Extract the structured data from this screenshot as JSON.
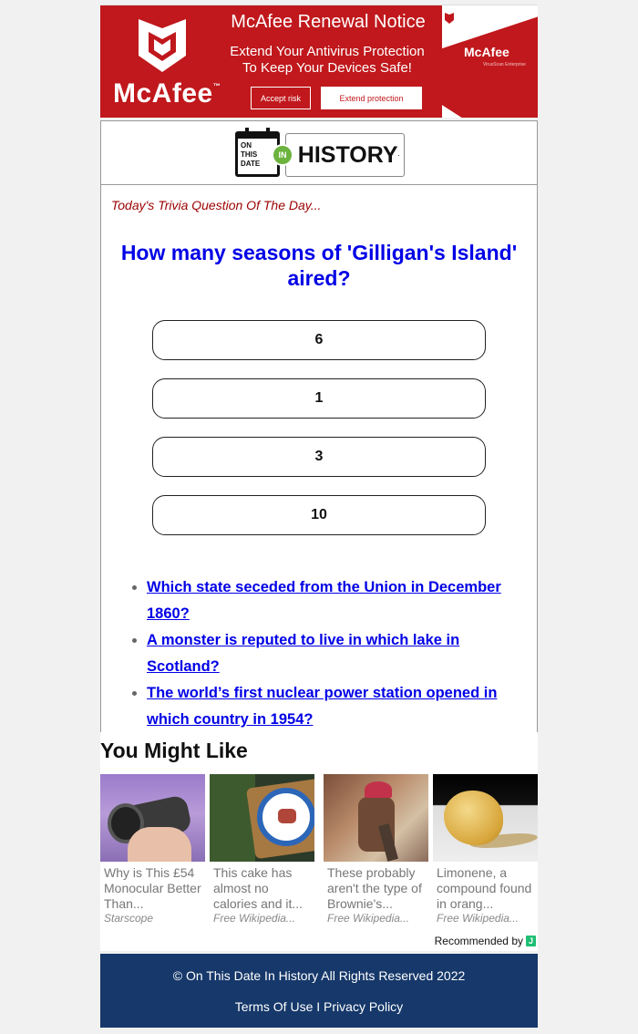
{
  "ad": {
    "brand": "McAfee",
    "trademark": "™",
    "title": "McAfee Renewal Notice",
    "subtitle_line1": "Extend Your Antivirus Protection",
    "subtitle_line2": "To Keep Your Devices Safe!",
    "accept_label": "Accept risk",
    "extend_label": "Extend protection",
    "box_brand": "McAfee",
    "box_product": "VirusScan Enterprise",
    "brand_color": "#c0181c"
  },
  "logo": {
    "calendar_line1": "ON",
    "calendar_line2": "THIS",
    "calendar_line3": "DATE",
    "in_badge": "IN",
    "wordmark": "HISTORY",
    "wordmark_dot": "."
  },
  "trivia": {
    "label": "Today's Trivia Question Of The Day...",
    "question": "How many seasons of 'Gilligan's Island' aired?",
    "answers": [
      "6",
      "1",
      "3",
      "10"
    ]
  },
  "related_questions": [
    "Which state seceded from the Union in December 1860?",
    "A monster is reputed to live in which lake in Scotland?",
    "The world’s first nuclear power station opened in which country in 1954?"
  ],
  "you_might_like": {
    "title": "You Might Like",
    "cards": [
      {
        "title": "Why is This £54 Monocular Better Than...",
        "source": "Starscope",
        "image": "monocular-photo"
      },
      {
        "title": "This cake has almost no calories and it...",
        "source": "Free Wikipedia...",
        "image": "cake-plate-photo"
      },
      {
        "title": "These probably aren't the type of Brownie's...",
        "source": "Free Wikipedia...",
        "image": "brownie-illustration"
      },
      {
        "title": "Limonene, a compound found in orang...",
        "source": "Free Wikipedia...",
        "image": "lemon-photo"
      }
    ],
    "recommended_by": "Recommended by",
    "recommender_icon": "J"
  },
  "footer": {
    "copyright": "© On This Date In History All Rights Reserved 2022",
    "terms": "Terms Of Use",
    "separator": " I ",
    "privacy": "Privacy Policy",
    "bg_color": "#16386a"
  }
}
